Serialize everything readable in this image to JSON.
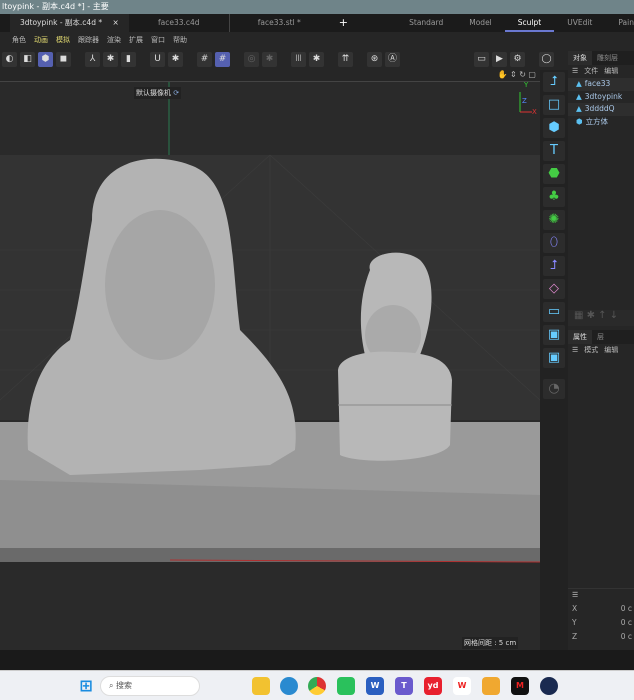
{
  "window": {
    "title": "ltoypink - 副本.c4d *] - 主要"
  },
  "tabs": [
    {
      "label": "3dtoypink - 副本.c4d *",
      "close": "×"
    },
    {
      "label": "face33.c4d"
    },
    {
      "label": "face33.stl *"
    },
    {
      "label": "+"
    }
  ],
  "layouts": [
    "Standard",
    "Model",
    "Sculpt",
    "UVEdit",
    "Pain"
  ],
  "active_layout": "Sculpt",
  "menu": [
    "角色",
    "动画",
    "模拟",
    "跟踪器",
    "渲染",
    "扩展",
    "窗口",
    "帮助"
  ],
  "viewport": {
    "camera": "默认摄像机",
    "grid_spacing": "网格间距 : 5 cm",
    "axes": {
      "y": "Y",
      "z": "Z",
      "x": "X"
    }
  },
  "object_panel": {
    "tabs": [
      "对象",
      "雕刻层"
    ],
    "menu": [
      "文件",
      "编辑"
    ],
    "objects": [
      {
        "name": "face33",
        "icon": "polygon-icon"
      },
      {
        "name": "3dtoypink",
        "icon": "polygon-icon"
      },
      {
        "name": "3ddddQ",
        "icon": "polygon-icon"
      },
      {
        "name": "立方体",
        "icon": "cube-icon"
      }
    ]
  },
  "attr_panel": {
    "tabs": [
      "属性",
      "层"
    ],
    "menu": [
      "模式",
      "编辑"
    ]
  },
  "coords": [
    {
      "axis": "X",
      "value": "0 c"
    },
    {
      "axis": "Y",
      "value": "0 c"
    },
    {
      "axis": "Z",
      "value": "0 c"
    }
  ],
  "taskbar": {
    "search_placeholder": "搜索",
    "apps": [
      "explorer",
      "edge",
      "chrome",
      "wechat",
      "word",
      "teams",
      "youdao",
      "wps",
      "reader",
      "mumu",
      "cinema4d"
    ]
  },
  "colors": {
    "accent": "#5560b0",
    "title_bar": "#6f8489"
  }
}
